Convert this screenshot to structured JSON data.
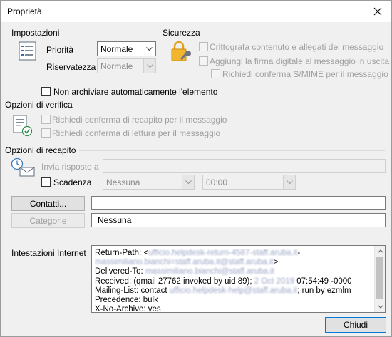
{
  "window": {
    "title": "Proprietà"
  },
  "settings": {
    "section_title": "Impostazioni",
    "priority_label": "Priorità",
    "priority_value": "Normale",
    "confidentiality_label": "Riservatezza",
    "confidentiality_value": "Normale",
    "no_archive_label": "Non archiviare automaticamente l'elemento"
  },
  "security": {
    "section_title": "Sicurezza",
    "encrypt_label": "Crittografa contenuto e allegati del messaggio",
    "digital_signature_label": "Aggiungi la firma digitale al messaggio in uscita",
    "smime_receipt_label": "Richiedi conferma S/MIME per il messaggio"
  },
  "tracking": {
    "section_title": "Opzioni di verifica",
    "delivery_receipt_label": "Richiedi conferma di recapito per il messaggio",
    "read_receipt_label": "Richiedi conferma di lettura per il messaggio"
  },
  "delivery": {
    "section_title": "Opzioni di recapito",
    "send_replies_label": "Invia risposte a",
    "send_replies_value": "",
    "expires_label": "Scadenza",
    "expires_date": "Nessuna",
    "expires_time": "00:00",
    "contacts_button": "Contatti...",
    "contacts_value": "",
    "categories_button": "Categorie",
    "categories_value": "Nessuna"
  },
  "internet_headers": {
    "label": "Intestazioni Internet",
    "lines": [
      {
        "prefix": "Return-Path: <",
        "masked": "ufficio.helpdesk-return-4587-staff.aruba.it",
        "suffix": "-"
      },
      {
        "prefix": "",
        "masked": "massimiliano.bianchi=staff.aruba.it@staff.aruba.it",
        "suffix": ">"
      },
      {
        "prefix": "Delivered-To: ",
        "masked": "massimiliano.bianchi@staff.aruba.it",
        "suffix": ""
      },
      {
        "prefix": "Received: (qmail 27762 invoked by uid 89); ",
        "masked": "2 Oct 2019",
        "suffix": " 07:54:49 -0000"
      },
      {
        "prefix": "Mailing-List: contact ",
        "masked": "ufficio.helpdesk-help@staff.aruba.it",
        "suffix": "; run by ezmlm"
      },
      {
        "prefix": "Precedence: bulk",
        "masked": "",
        "suffix": ""
      },
      {
        "prefix": "X-No-Archive: yes",
        "masked": "",
        "suffix": ""
      }
    ]
  },
  "footer": {
    "close_button": "Chiudi"
  },
  "colors": {
    "accent": "#0078d7",
    "window_bg": "#f0f0f0"
  }
}
